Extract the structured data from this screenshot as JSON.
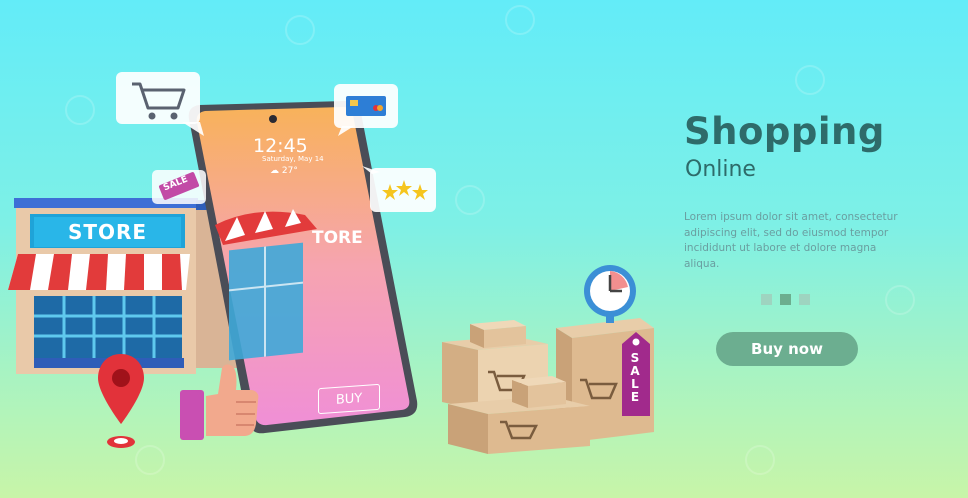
{
  "hero": {
    "title": "Shopping",
    "subtitle": "Online",
    "description": "Lorem ipsum dolor sit amet, consectetur adipiscing elit, sed do eiusmod tempor incididunt ut labore et dolore magna aliqua."
  },
  "cta": {
    "label": "Buy now"
  },
  "carousel": {
    "count": 3,
    "active_index": 1
  },
  "phone": {
    "time": "12:45",
    "date": "Saturday, May 14",
    "weather": "☁ 27°",
    "buy_label": "BUY"
  },
  "store": {
    "sign_left": "STORE",
    "sign_right": "TORE"
  },
  "bubbles": {
    "sale_label": "SALE"
  },
  "tag": {
    "sale_label": "S A L E"
  },
  "rating": {
    "stars": 3
  },
  "colors": {
    "accent": "#6cae90",
    "title": "#2e6b6a",
    "awning_red": "#e23b3b",
    "sale_tag": "#a12a8c",
    "location_pin": "#e2323a"
  },
  "icons": [
    "shopping-cart-icon",
    "credit-card-icon",
    "star-icon",
    "sale-tag-icon",
    "location-pin-icon",
    "thumbs-up-icon",
    "clock-icon"
  ]
}
